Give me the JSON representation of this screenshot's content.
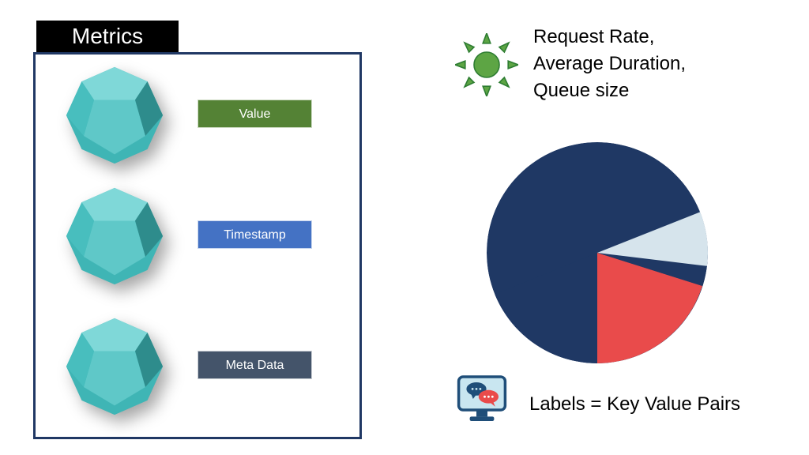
{
  "title": "Metrics",
  "rows": [
    {
      "label": "Value",
      "color": "green"
    },
    {
      "label": "Timestamp",
      "color": "blue"
    },
    {
      "label": "Meta Data",
      "color": "dark"
    }
  ],
  "right_text": {
    "line1": "Request Rate,",
    "line2": "Average Duration,",
    "line3": "Queue size",
    "bottom": "Labels = Key Value Pairs"
  },
  "colors": {
    "box_border": "#203864",
    "green": "#548235",
    "blue": "#4472C4",
    "dark": "#44546A",
    "gem_light": "#5FC8C8",
    "gem_mid": "#3FB5B5",
    "gem_dark": "#2E8C8C",
    "pie_navy": "#1F3864",
    "pie_red": "#E94B4B",
    "pie_light": "#D6E4EC",
    "sun_fill": "#5DA544",
    "sun_stroke": "#2E7D32",
    "mon_body": "#C9E6F0",
    "mon_frame": "#1F4E79"
  },
  "chart_data": {
    "type": "pie",
    "title": "",
    "series": [
      {
        "name": "navy",
        "value": 68,
        "color": "#1F3864"
      },
      {
        "name": "red",
        "value": 22,
        "color": "#E94B4B"
      },
      {
        "name": "light",
        "value": 10,
        "color": "#D6E4EC"
      }
    ]
  }
}
